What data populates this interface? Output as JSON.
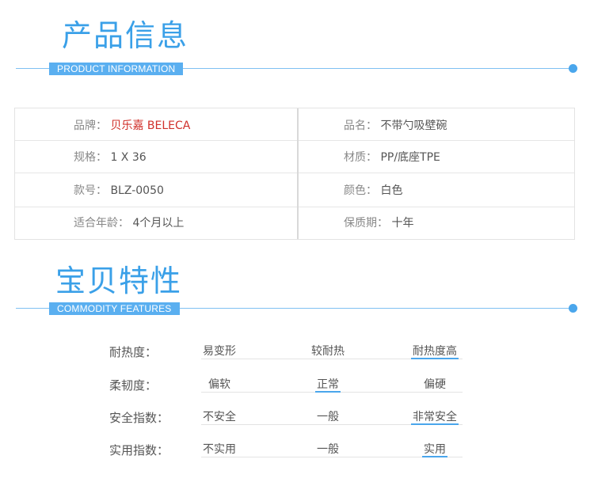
{
  "section1": {
    "title": "产品信息",
    "subtitle": "PRODUCT INFORMATION"
  },
  "product_info": {
    "brand_key": "品牌：",
    "brand_value": "贝乐嘉 BELECA",
    "name_key": "品名：",
    "name_value": "不带勺吸壁碗",
    "spec_key": "规格：",
    "spec_value": "1 X 36",
    "material_key": "材质：",
    "material_value": "PP/底座TPE",
    "model_key": "款号：",
    "model_value": "BLZ-0050",
    "color_key": "颜色：",
    "color_value": "白色",
    "age_key": "适合年龄：",
    "age_value": "4个月以上",
    "shelf_key": "保质期：",
    "shelf_value": "十年"
  },
  "section2": {
    "title": "宝贝特性",
    "subtitle": "COMMODITY FEATURES"
  },
  "features": [
    {
      "label": "耐热度：",
      "options": [
        "易变形",
        "较耐热",
        "耐热度高"
      ],
      "selected": 2
    },
    {
      "label": "柔韧度：",
      "options": [
        "偏软",
        "正常",
        "偏硬"
      ],
      "selected": 1
    },
    {
      "label": "安全指数：",
      "options": [
        "不安全",
        "一般",
        "非常安全"
      ],
      "selected": 2
    },
    {
      "label": "实用指数：",
      "options": [
        "不实用",
        "一般",
        "实用"
      ],
      "selected": 2
    }
  ],
  "colors": {
    "accent": "#4aa6ec",
    "brand_red": "#d0302b"
  }
}
